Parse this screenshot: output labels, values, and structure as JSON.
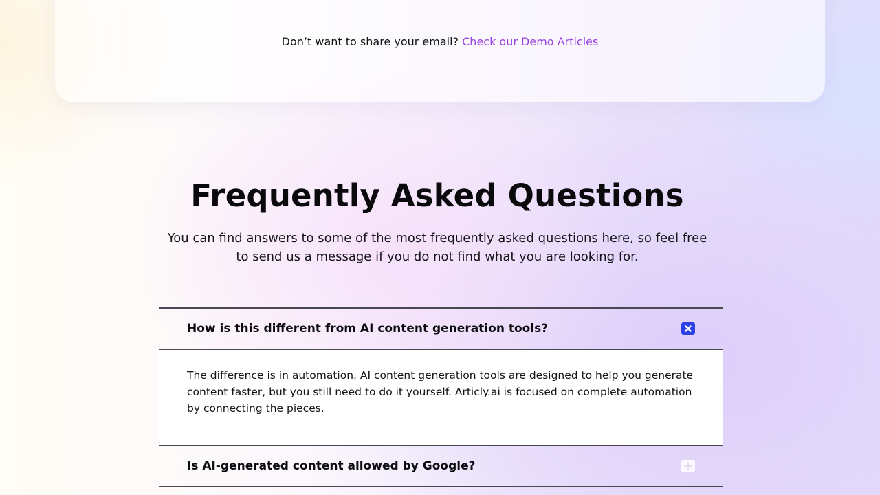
{
  "top_card": {
    "prompt_text": "Don’t want to share your email?",
    "link_text": "Check our Demo Articles",
    "link_color": "#9a43e0"
  },
  "faq": {
    "title": "Frequently Asked Questions",
    "subtitle": "You can find answers to some of the most frequently asked questions here, so feel free to send us a message if you do not find what you are looking for.",
    "items": [
      {
        "question": "How is this different from AI content generation tools?",
        "expanded": true,
        "toggle_icon": "close-icon",
        "answer": "The difference is in automation. AI content generation tools are designed to help you generate content faster, but you still need to do it yourself. Articly.ai is focused on complete automation by connecting the pieces."
      },
      {
        "question": "Is AI-generated content allowed by Google?",
        "expanded": false,
        "toggle_icon": "plus-icon"
      }
    ],
    "accent_color": "#2d41e6"
  }
}
